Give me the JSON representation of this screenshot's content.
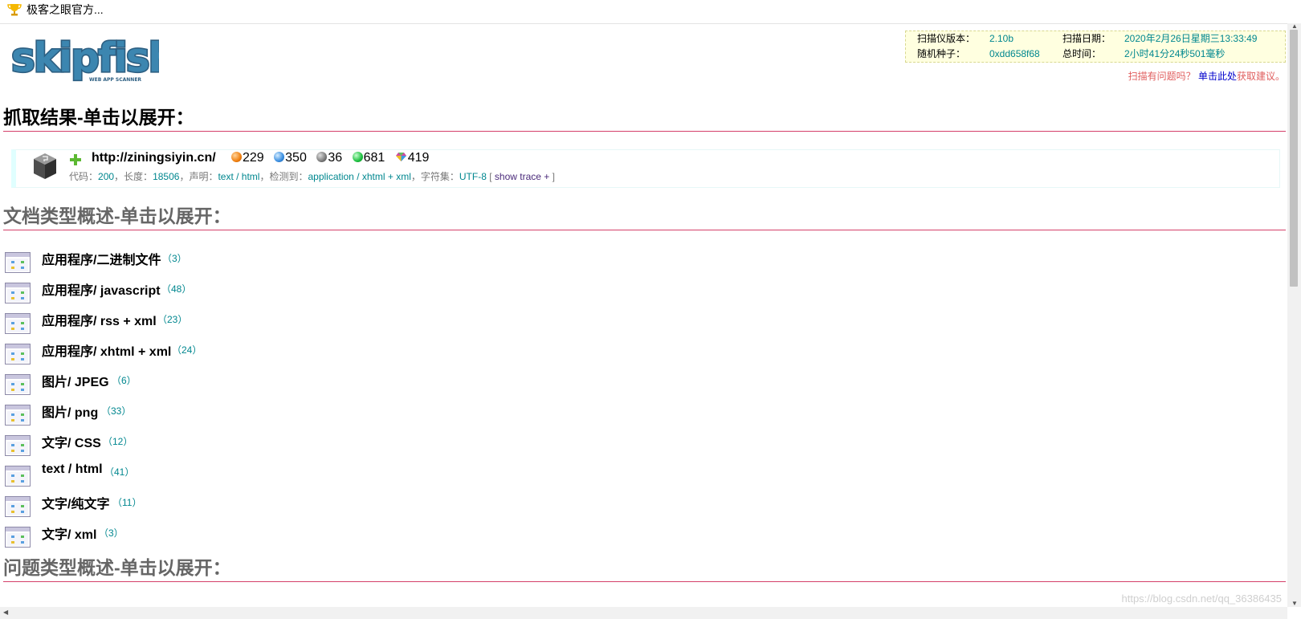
{
  "window": {
    "title": "极客之眼官方..."
  },
  "logo": {
    "text": "skipfish",
    "subtitle": "WEB APP SCANNER"
  },
  "scan_info": {
    "version_label": "扫描仪版本：",
    "version": "2.10b",
    "date_label": "扫描日期：",
    "date": "2020年2月26日星期三13:33:49",
    "seed_label": "随机种子：",
    "seed": "0xdd658f68",
    "total_label": "总时间：",
    "total": "2小时41分24秒501毫秒"
  },
  "feedback": {
    "prefix": "扫描有问题吗？",
    "link": "单击此处",
    "suffix": "获取建议。"
  },
  "sections": {
    "crawl": "抓取结果-单击以展开：",
    "doctypes": "文档类型概述-单击以展开：",
    "issues": "问题类型概述-单击以展开："
  },
  "result": {
    "url": "http://ziningsiyin.cn/",
    "counts": [
      {
        "value": "229",
        "color": "#f08010"
      },
      {
        "value": "350",
        "color": "#3a8ee0"
      },
      {
        "value": "36",
        "color": "#7a7a7a"
      },
      {
        "value": "681",
        "color": "#1ec040"
      },
      {
        "value": "419",
        "color": "#d04aa0"
      }
    ],
    "meta": {
      "code_label": "代码：",
      "code": "200",
      "length_label": "，长度：",
      "length": "18506",
      "declared_label": "，声明：",
      "declared": "text / html",
      "detected_label": "，检测到：",
      "detected": "application / xhtml + xml",
      "charset_label": "，字符集：",
      "charset": "UTF-8",
      "open": " [ ",
      "trace": "show trace +",
      "close": " ]"
    }
  },
  "doc_types": [
    {
      "label": "应用程序/二进制文件",
      "count": "（3）"
    },
    {
      "label": "应用程序/ javascript",
      "count": "（48）"
    },
    {
      "label": "应用程序/ rss + xml",
      "count": "（23）"
    },
    {
      "label": "应用程序/ xhtml + xml",
      "count": "（24）"
    },
    {
      "label": "图片/ JPEG",
      "count": "（6）"
    },
    {
      "label": "图片/ png",
      "count": "（33）"
    },
    {
      "label": "文字/ CSS",
      "count": "（12）"
    },
    {
      "label": "text / html",
      "count": "（41）"
    },
    {
      "label": "文字/纯文字",
      "count": "（11）"
    },
    {
      "label": "文字/ xml",
      "count": "（3）"
    }
  ],
  "watermark": "https://blog.csdn.net/qq_36386435"
}
